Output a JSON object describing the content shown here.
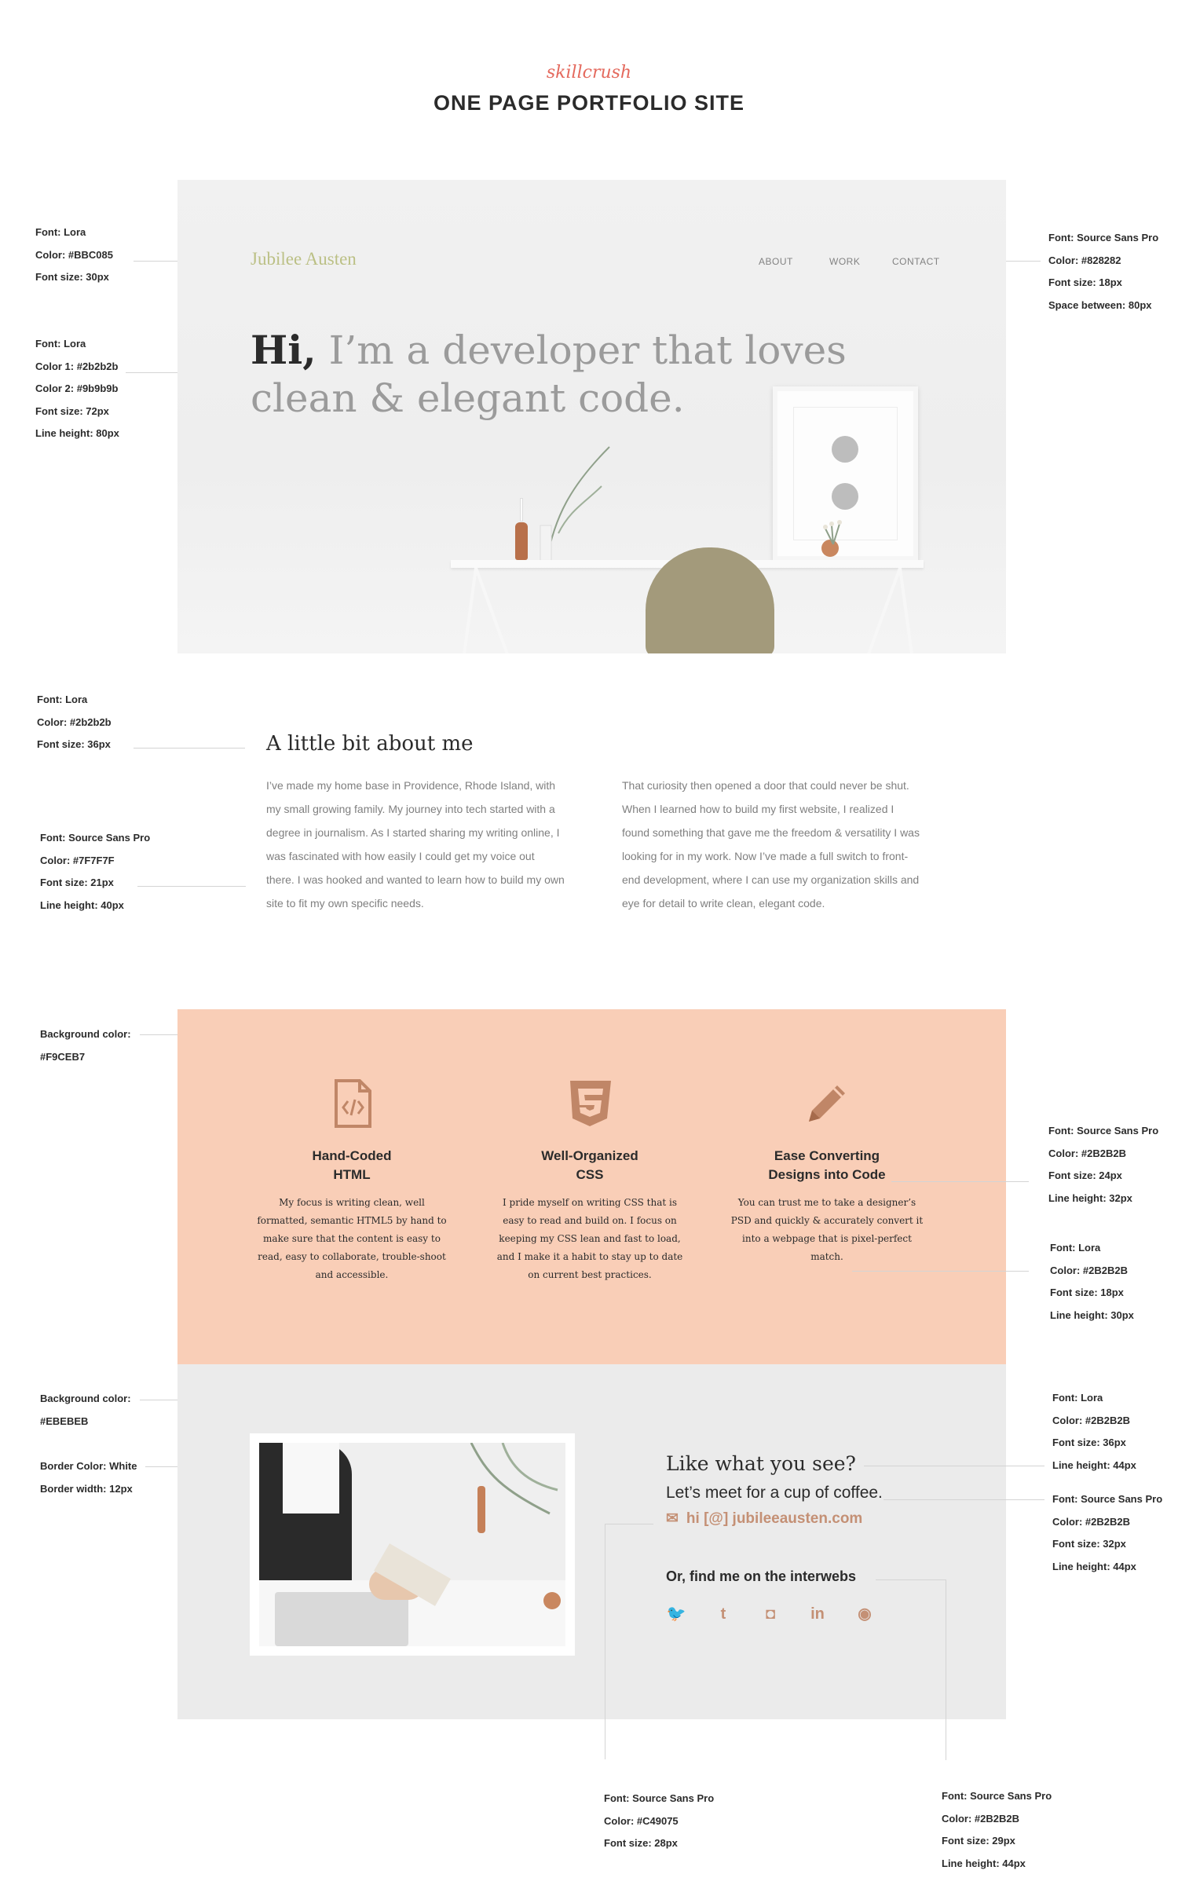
{
  "page": {
    "brand": "skillcrush",
    "title": "ONE PAGE PORTFOLIO SITE"
  },
  "site": {
    "name": "Jubilee Austen",
    "nav": [
      "ABOUT",
      "WORK",
      "CONTACT"
    ],
    "headline_bold": "Hi,",
    "headline_rest": "I’m a developer that loves clean & elegant code."
  },
  "about": {
    "title": "A little bit about me",
    "col1": "I’ve made my home base in Providence, Rhode Island, with my small growing family. My journey into tech started with a degree in journalism. As I started sharing my writing online, I was fascinated with how easily I could get my voice out there. I was hooked and wanted to learn how to build my own site to fit my own specific needs.",
    "col2": "That curiosity then opened a door that could never be shut. When I learned how to build my first website, I realized I found something that gave me the freedom & versatility I was looking for in my work. Now I’ve made a full switch to front-end development, where I can use my organization skills and eye for detail to write clean, elegant code."
  },
  "skills": [
    {
      "icon": "html-file-icon",
      "title_1": "Hand-Coded",
      "title_2": "HTML",
      "text": "My focus is writing clean, well formatted, semantic HTML5 by hand to make sure that the content is easy to read, easy to collaborate, trouble-shoot and accessible."
    },
    {
      "icon": "css3-icon",
      "title_1": "Well-Organized",
      "title_2": "CSS",
      "text": "I pride myself on writing CSS that is easy to read and build on. I focus on keeping my CSS lean and fast to load, and I make it a habit to stay up to date on current best practices."
    },
    {
      "icon": "pencil-icon",
      "title_1": "Ease Converting",
      "title_2": "Designs into Code",
      "text": "You can trust me to take a designer’s PSD and quickly & accurately convert it into a webpage that is pixel-perfect match."
    }
  ],
  "contact": {
    "title": "Like what you see?",
    "subtitle": "Let’s meet for a cup of coffee.",
    "email": "hi [@] jubileeausten.com",
    "social_title": "Or, find me on the interwebs",
    "socials": [
      "twitter-icon",
      "tumblr-icon",
      "instagram-icon",
      "linkedin-icon",
      "github-icon"
    ]
  },
  "specs": {
    "logo": [
      "Font: Lora",
      "Color: #BBC085",
      "Font size: 30px"
    ],
    "nav": [
      "Font: Source Sans Pro",
      "Color: #828282",
      "Font size: 18px",
      "Space between: 80px"
    ],
    "headline": [
      "Font: Lora",
      "Color 1: #2b2b2b",
      "Color 2: #9b9b9b",
      "Font size: 72px",
      "Line height: 80px"
    ],
    "about_title": [
      "Font: Lora",
      "Color: #2b2b2b",
      "Font size: 36px"
    ],
    "about_body": [
      "Font: Source Sans Pro",
      "Color: #7F7F7F",
      "Font size: 21px",
      "Line height: 40px"
    ],
    "skills_bg": [
      "Background color:",
      "#F9CEB7"
    ],
    "skill_title": [
      "Font: Source Sans Pro",
      "Color: #2B2B2B",
      "Font size: 24px",
      "Line height: 32px"
    ],
    "skill_text": [
      "Font: Lora",
      "Color: #2B2B2B",
      "Font size: 18px",
      "Line height: 30px"
    ],
    "contact_bg": [
      "Background color:",
      "#EBEBEB"
    ],
    "photo_border": [
      "Border Color:  White",
      "Border width: 12px"
    ],
    "contact_title": [
      "Font: Lora",
      "Color: #2B2B2B",
      "Font size: 36px",
      "Line height: 44px"
    ],
    "contact_sub": [
      "Font: Source Sans Pro",
      "Color: #2B2B2B",
      "Font size: 32px",
      "Line height: 44px"
    ],
    "email_spec": [
      "Font: Source Sans Pro",
      "Color: #C49075",
      "Font size: 28px"
    ],
    "social_spec": [
      "Font: Source Sans Pro",
      "Color: #2B2B2B",
      "Font size: 29px",
      "Line height: 44px"
    ]
  }
}
